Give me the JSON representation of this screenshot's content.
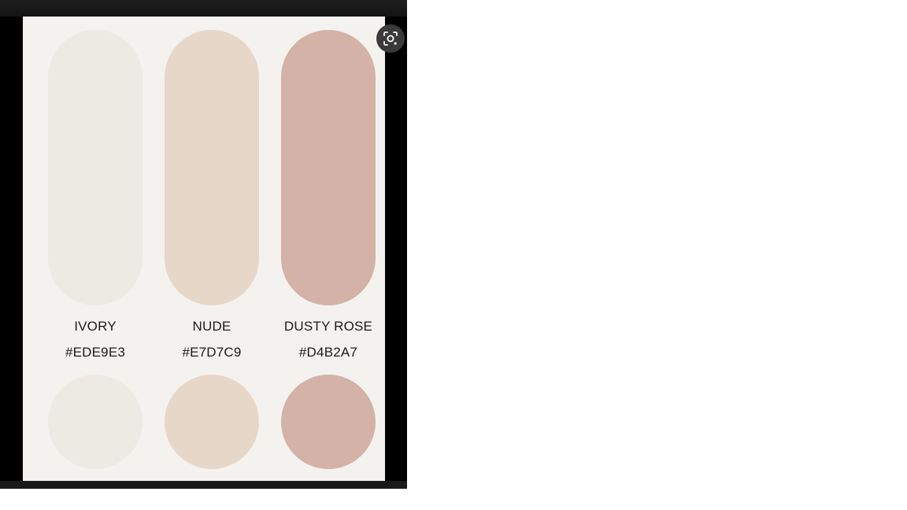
{
  "palette": {
    "swatches": [
      {
        "name": "IVORY",
        "hex": "#EDE9E3",
        "color": "#EDE9E3"
      },
      {
        "name": "NUDE",
        "hex": "#E7D7C9",
        "color": "#E7D7C9"
      },
      {
        "name": "DUSTY ROSE",
        "hex": "#D4B2A7",
        "color": "#D4B2A7"
      }
    ]
  },
  "toolbar": {
    "lens_icon": "visual-search-icon"
  },
  "colors": {
    "viewer_background": "#000000",
    "image_background": "#F4F2EE",
    "text": "#1A1A1A"
  }
}
